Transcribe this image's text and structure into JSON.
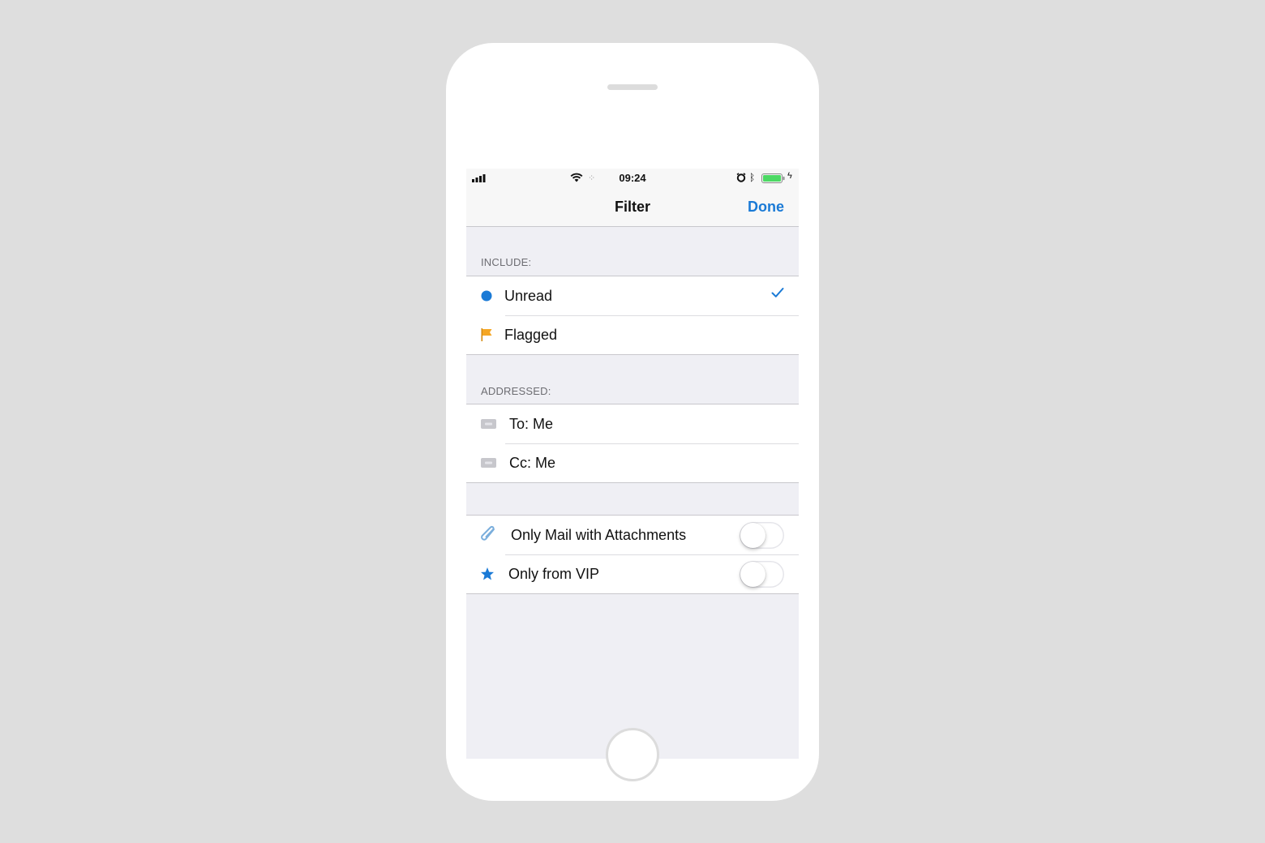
{
  "status_bar": {
    "time": "09:24"
  },
  "nav": {
    "title": "Filter",
    "done_label": "Done"
  },
  "include": {
    "header": "INCLUDE:",
    "items": [
      {
        "label": "Unread",
        "checked": true,
        "icon": "unread-dot-icon"
      },
      {
        "label": "Flagged",
        "checked": false,
        "icon": "flag-icon"
      }
    ]
  },
  "addressed": {
    "header": "ADDRESSED:",
    "items": [
      {
        "label": "To: Me",
        "icon": "to-badge-icon"
      },
      {
        "label": "Cc: Me",
        "icon": "cc-badge-icon"
      }
    ]
  },
  "options": {
    "items": [
      {
        "label": "Only Mail with Attachments",
        "enabled": false,
        "icon": "paperclip-icon"
      },
      {
        "label": "Only from VIP",
        "enabled": false,
        "icon": "star-icon"
      }
    ]
  },
  "colors": {
    "accent": "#1a7ad6",
    "flag": "#f5a623",
    "background": "#efeff4"
  }
}
